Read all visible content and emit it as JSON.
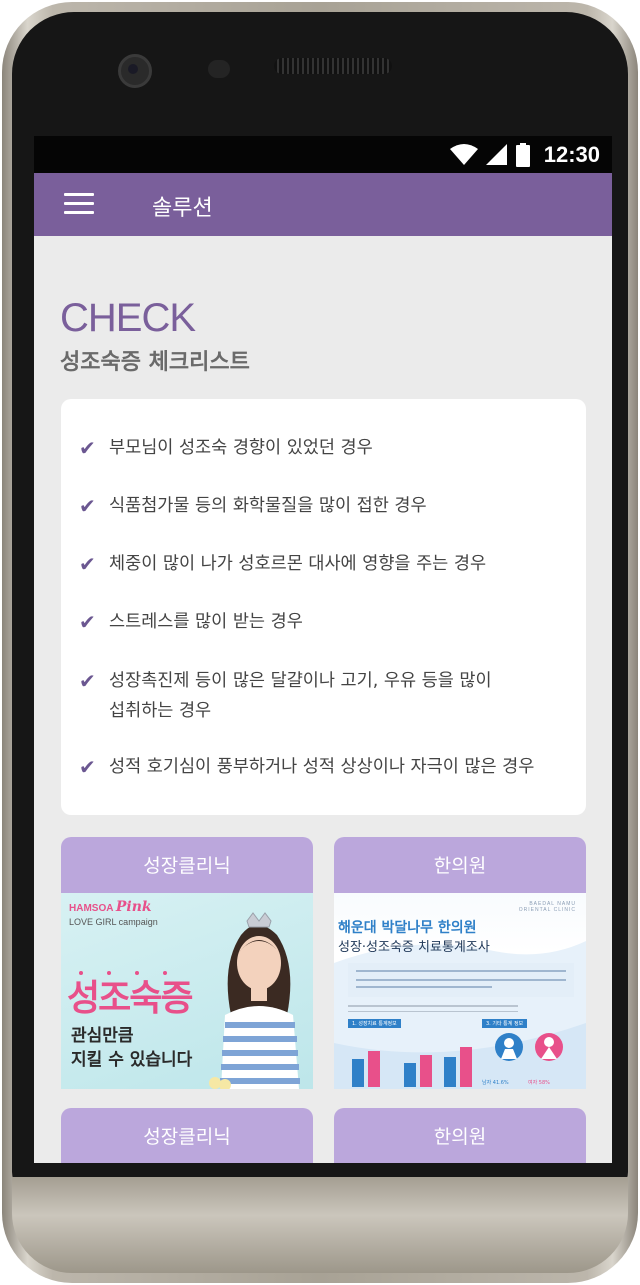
{
  "status_bar": {
    "time": "12:30"
  },
  "app_bar": {
    "title": "솔루션"
  },
  "section": {
    "heading": "CHECK",
    "subheading": "성조숙증 체크리스트"
  },
  "checklist": [
    {
      "line1": "부모님이 성조숙 경향이 있었던 경우",
      "line2": ""
    },
    {
      "line1": "식품첨가물 등의 화학물질을 많이 접한 경우",
      "line2": ""
    },
    {
      "line1": "체중이 많이 나가 성호르몬 대사에 영향을 주는 경우",
      "line2": ""
    },
    {
      "line1": "스트레스를 많이 받는 경우",
      "line2": ""
    },
    {
      "line1": "성장촉진제 등이 많은 달걀이나 고기, 우유 등을 많이",
      "line2": "섭취하는 경우"
    },
    {
      "line1": "성적 호기심이 풍부하거나 성적 상상이나 자극이 많은 경우",
      "line2": ""
    }
  ],
  "tiles": [
    {
      "label": "성장클리닉"
    },
    {
      "label": "한의원"
    },
    {
      "label": "성장클리닉"
    },
    {
      "label": "한의원"
    }
  ],
  "banner_pink": {
    "brand": "HAMSOA",
    "brand_script": "Pink",
    "campaign": "LOVE GIRL campaign",
    "headline": "성조숙증",
    "sub1": "관심만큼",
    "sub2": "지킬 수 있습니다"
  },
  "banner_survey": {
    "clinic_en1": "BAEDAL NAMU",
    "clinic_en2": "ORIENTAL CLINIC",
    "title1": "해운대 박달나무 한의원",
    "title2": "성장·성조숙증 치료통계조사",
    "section1": "1. 성장치료 통계정보",
    "section2": "3. 기타 통계 정보",
    "male": "남자 41.6%",
    "female": "여자 58%"
  },
  "colors": {
    "primary": "#7a5f9b",
    "tile_header": "#bba7dc",
    "pink": "#e8508a",
    "blue": "#2f80c8"
  }
}
